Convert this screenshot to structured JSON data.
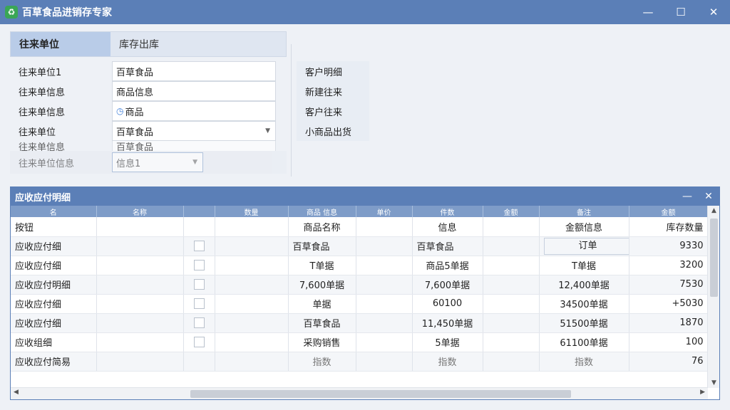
{
  "window": {
    "title": "百草食品进销存专家",
    "icon_glyph": "♻",
    "controls": {
      "minimize": "—",
      "maximize": "☐",
      "close": "✕"
    }
  },
  "tabs": [
    {
      "label": "往来单位",
      "active": true
    },
    {
      "label": "库存出库",
      "active": false
    }
  ],
  "form": {
    "rows": [
      {
        "label": "往来单位1",
        "value": "百草食品"
      },
      {
        "label": "往来单信息",
        "value": "商品信息"
      },
      {
        "label": "往来单信息",
        "value": "商品",
        "icon": "clock-icon"
      },
      {
        "label": "往来单位",
        "value": "百草食品",
        "dropdown": true
      },
      {
        "label": "往来单信息",
        "value": "百草食品"
      },
      {
        "label": "往来单位信息",
        "value": "信息1",
        "dropdown": true
      }
    ]
  },
  "side_links": [
    "客户明细",
    "新建往来",
    "客户往来",
    "小商品出货"
  ],
  "grid": {
    "title": "应收应付明细",
    "controls": {
      "minimize": "—",
      "close": "✕"
    },
    "headers": [
      "名",
      "名称",
      "",
      "数量",
      "商品 信息",
      "单价",
      "件数",
      "金额",
      "备注",
      "金额"
    ],
    "rows": [
      {
        "name": "按钮",
        "checkbox": false,
        "c3": "",
        "c4": "商品名称",
        "c5": "",
        "c6": "信息",
        "c7": "",
        "c8": "金额信息",
        "c9": "",
        "c10": "库存数量"
      },
      {
        "name": "应收应付细",
        "checkbox": true,
        "c3": "",
        "c4": "百草食品",
        "c5": "",
        "c6": "百草食品",
        "c7": "",
        "c8": "订单",
        "c9": "",
        "c10": "9330"
      },
      {
        "name": "应收应付细",
        "checkbox": true,
        "c3": "",
        "c4": "T单据",
        "c5": "",
        "c6": "商品5单据",
        "c7": "",
        "c8": "T单据",
        "c9": "",
        "c10": "3200"
      },
      {
        "name": "应收应付明细",
        "checkbox": true,
        "c3": "",
        "c4": "7,600单据",
        "c5": "",
        "c6": "7,600单据",
        "c7": "",
        "c8": "12,400单据",
        "c9": "",
        "c10": "7530"
      },
      {
        "name": "应收应付细",
        "checkbox": true,
        "c3": "",
        "c4": "单据",
        "c5": "",
        "c6": "60100",
        "c7": "",
        "c8": "34500单据",
        "c9": "",
        "c10": "+5030"
      },
      {
        "name": "应收应付细",
        "checkbox": true,
        "c3": "",
        "c4": "百草食品",
        "c5": "",
        "c6": "11,450单据",
        "c7": "",
        "c8": "51500单据",
        "c9": "",
        "c10": "1870"
      },
      {
        "name": "应收组细",
        "checkbox": true,
        "c3": "",
        "c4": "采购销售",
        "c5": "",
        "c6": "5单据",
        "c7": "",
        "c8": "61100单据",
        "c9": "",
        "c10": "100"
      },
      {
        "name": "应收应付简易",
        "checkbox": false,
        "c3": "",
        "c4": "指数",
        "c5": "",
        "c6": "指数",
        "c7": "",
        "c8": "指数",
        "c9": "",
        "c10": "76"
      }
    ]
  },
  "colors": {
    "titlebar": "#5b7fb7",
    "header": "#7e9cc8",
    "tab_active": "#b9cce8"
  }
}
